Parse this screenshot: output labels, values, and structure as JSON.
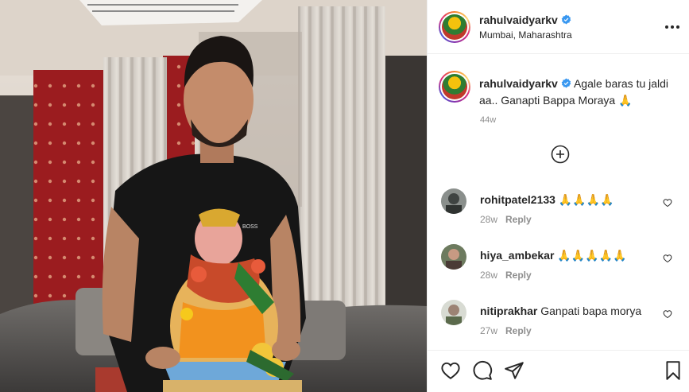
{
  "post": {
    "author": "rahulvaidyarkv",
    "location": "Mumbai, Maharashtra",
    "caption_text": "Agale baras tu jaldi aa.. Ganapti Bappa Moraya 🙏",
    "caption_time": "44w",
    "verified_icon": "verified-badge-icon"
  },
  "comments": [
    {
      "user": "rohitpatel2133",
      "text": "🙏🙏🙏🙏",
      "time": "28w",
      "reply": "Reply"
    },
    {
      "user": "hiya_ambekar",
      "text": "🙏🙏🙏🙏🙏",
      "time": "28w",
      "reply": "Reply"
    },
    {
      "user": "nitiprakhar",
      "text": "Ganpati bapa morya",
      "time": "27w",
      "reply": "Reply"
    }
  ],
  "colors": {
    "verified": "#3897f0",
    "text": "#262626",
    "muted": "#8e8e8e",
    "border": "#efefef"
  }
}
